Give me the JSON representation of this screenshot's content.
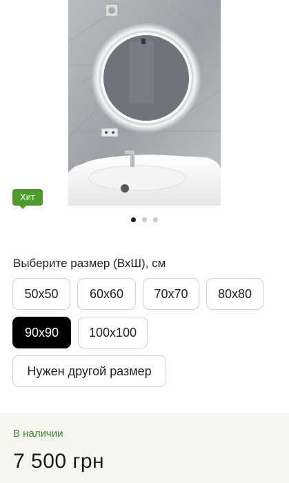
{
  "gallery": {
    "image_alt": "Round LED mirror above a white washbasin",
    "badge": "Хит",
    "dots": [
      {
        "active": true
      },
      {
        "active": false
      },
      {
        "active": false
      }
    ]
  },
  "size_picker": {
    "label": "Выберите размер (ВхШ), см",
    "options": [
      "50x50",
      "60x60",
      "70x70",
      "80x80",
      "90x90",
      "100x100"
    ],
    "selected": "90x90",
    "other_size_label": "Нужен другой размер"
  },
  "availability": {
    "status": "В наличии",
    "status_color": "#3a8a2a",
    "price": "7 500 грн"
  }
}
